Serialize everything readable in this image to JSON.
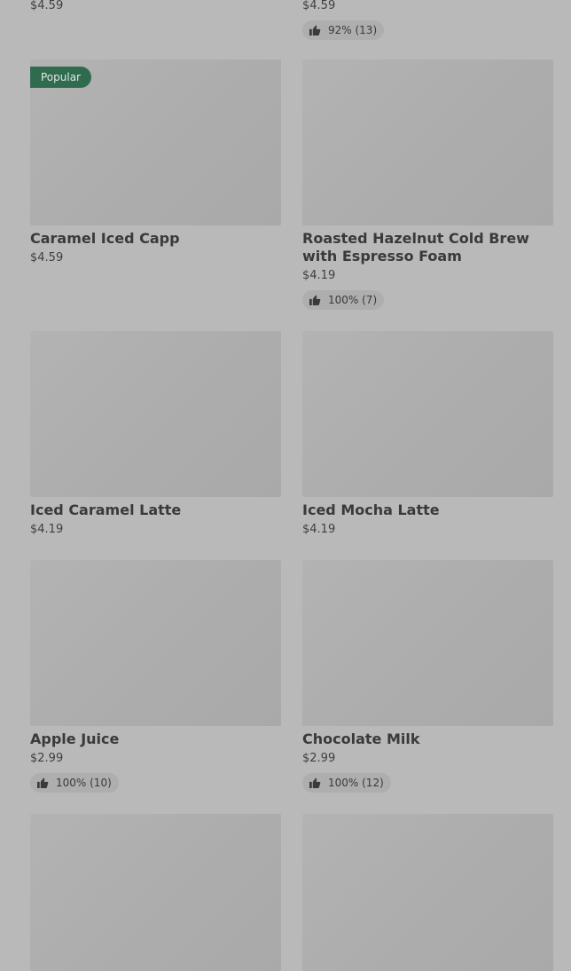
{
  "partial_top": {
    "left_price": "$4.59",
    "right_price": "$4.59",
    "right_rating": "92% (13)"
  },
  "products": [
    {
      "name": "Caramel Iced Capp",
      "price": "$4.59",
      "badge": "Popular",
      "rating": ""
    },
    {
      "name": "Roasted Hazelnut Cold Brew with Espresso Foam",
      "price": "$4.19",
      "badge": "",
      "rating": "100% (7)"
    },
    {
      "name": "Iced Caramel Latte",
      "price": "$4.19",
      "badge": "",
      "rating": ""
    },
    {
      "name": "Iced Mocha Latte",
      "price": "$4.19",
      "badge": "",
      "rating": ""
    },
    {
      "name": "Apple Juice",
      "price": "$2.99",
      "badge": "",
      "rating": "100% (10)"
    },
    {
      "name": "Chocolate Milk",
      "price": "$2.99",
      "badge": "",
      "rating": "100% (12)"
    }
  ],
  "icons": {
    "rating": "thumbs-up-icon"
  },
  "colors": {
    "background": "#b9b9b9",
    "popular_badge": "#2f6c4f"
  }
}
